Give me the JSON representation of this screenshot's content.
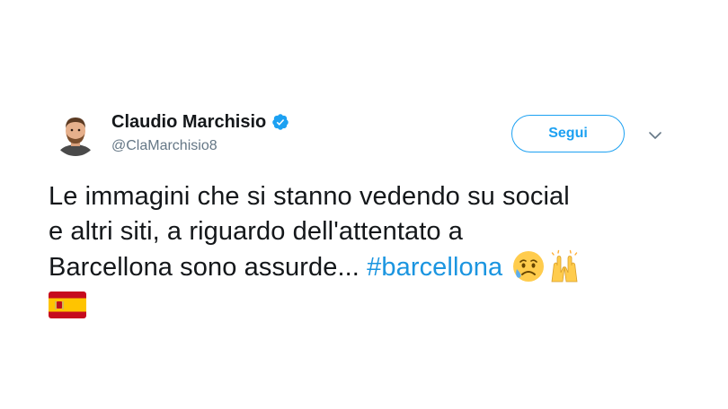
{
  "user": {
    "display_name": "Claudio Marchisio",
    "handle": "@ClaMarchisio8",
    "verified": true,
    "avatar_icon": "profile-photo"
  },
  "follow_button": {
    "label": "Segui"
  },
  "menu": {
    "icon": "chevron-down-icon"
  },
  "tweet": {
    "text_line_1": "Le immagini che si stanno vedendo su social",
    "text_line_2": "e altri siti, a riguardo dell'attentato a",
    "text_line_3_prefix": "Barcellona sono assurde... ",
    "hashtag": "#barcellona",
    "emojis": [
      "sad-but-relieved-face-emoji",
      "raising-hands-emoji",
      "spain-flag-emoji"
    ]
  },
  "colors": {
    "accent": "#1da1f2",
    "hashtag": "#1b95e0",
    "text": "#14171a",
    "secondary_text": "#657786"
  }
}
